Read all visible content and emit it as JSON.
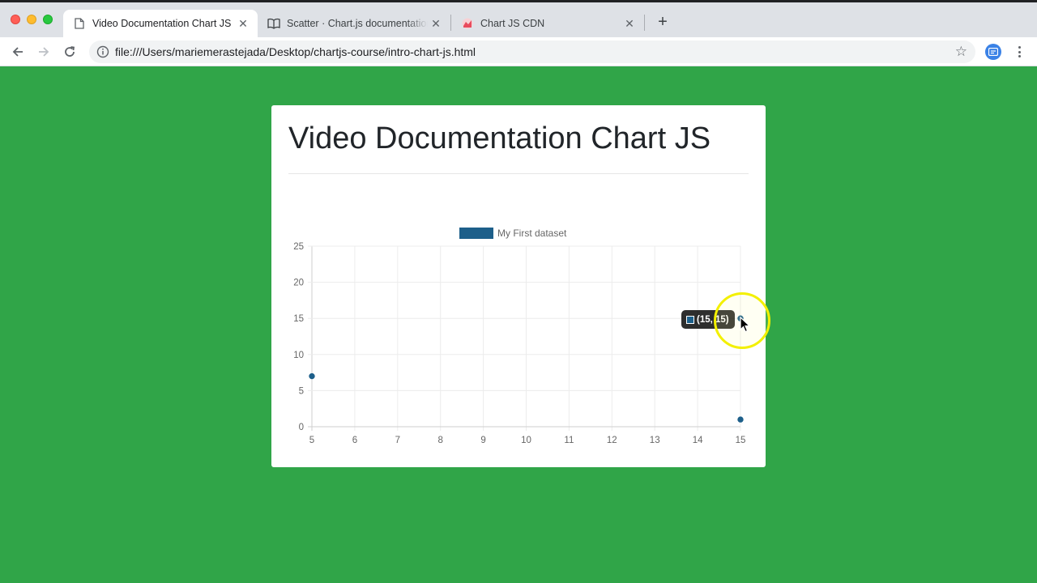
{
  "browser": {
    "tabs": [
      {
        "title": "Video Documentation Chart JS",
        "icon": "document-icon",
        "active": true
      },
      {
        "title": "Scatter · Chart.js documentation",
        "icon": "book-icon",
        "active": false
      },
      {
        "title": "Chart JS CDN",
        "icon": "chartjs-logo-icon",
        "active": false
      }
    ],
    "close_glyph": "✕",
    "new_tab_glyph": "+",
    "url": "file:///Users/mariemerastejada/Desktop/chartjs-course/intro-chart-js.html",
    "colors": {
      "page_background": "#30a548",
      "tab_strip": "#dee1e6"
    }
  },
  "page": {
    "title": "Video Documentation Chart JS"
  },
  "tooltip": {
    "text": "(15, 15)"
  },
  "chart_data": {
    "type": "scatter",
    "title": "",
    "xlabel": "",
    "ylabel": "",
    "series": [
      {
        "name": "My First dataset",
        "color": "#1d5f8a",
        "points": [
          {
            "x": 5,
            "y": 7
          },
          {
            "x": 15,
            "y": 15
          },
          {
            "x": 15,
            "y": 1
          }
        ]
      }
    ],
    "xlim": [
      5,
      15
    ],
    "ylim": [
      0,
      25
    ],
    "x_ticks": [
      5,
      6,
      7,
      8,
      9,
      10,
      11,
      12,
      13,
      14,
      15
    ],
    "y_ticks": [
      0,
      5,
      10,
      15,
      20,
      25
    ],
    "grid": true,
    "legend": "top-center"
  }
}
